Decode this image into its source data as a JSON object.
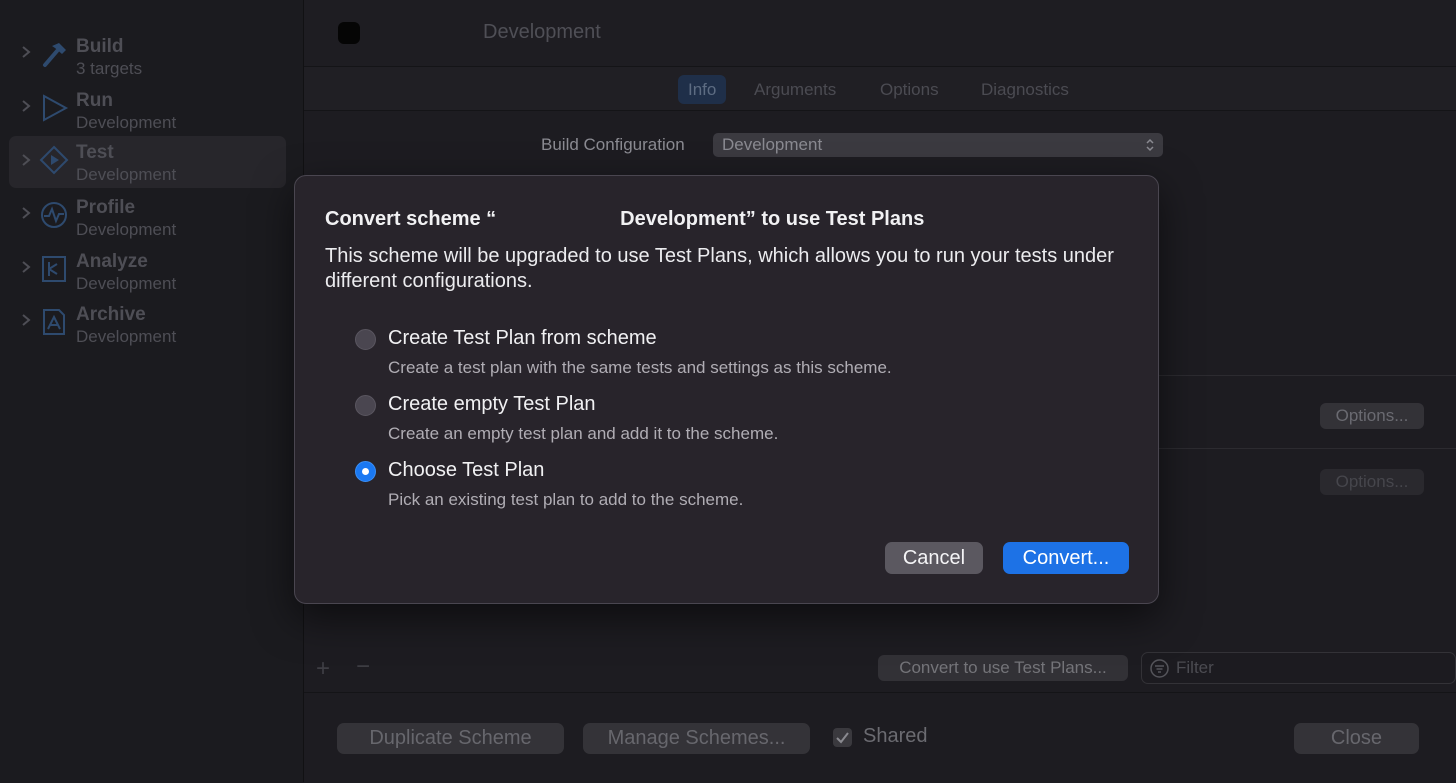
{
  "sidebar": {
    "items": [
      {
        "title": "Build",
        "subtitle": "3 targets",
        "icon": "hammer-icon"
      },
      {
        "title": "Run",
        "subtitle": "Development",
        "icon": "play-icon"
      },
      {
        "title": "Test",
        "subtitle": "Development",
        "icon": "test-diamond-icon"
      },
      {
        "title": "Profile",
        "subtitle": "Development",
        "icon": "instruments-icon"
      },
      {
        "title": "Analyze",
        "subtitle": "Development",
        "icon": "analyze-icon"
      },
      {
        "title": "Archive",
        "subtitle": "Development",
        "icon": "archive-icon"
      }
    ],
    "selected": "Test"
  },
  "header": {
    "scheme_name": "Development"
  },
  "tabs": [
    {
      "label": "Info",
      "active": true
    },
    {
      "label": "Arguments"
    },
    {
      "label": "Options"
    },
    {
      "label": "Diagnostics"
    }
  ],
  "info": {
    "build_config_label": "Build Configuration",
    "build_config_value": "Development",
    "options_label_1": "Options...",
    "options_label_2": "Options...",
    "convert_test_plans_label": "Convert to use Test Plans...",
    "filter_placeholder": "Filter"
  },
  "footer": {
    "duplicate": "Duplicate Scheme",
    "manage": "Manage Schemes...",
    "shared_label": "Shared",
    "shared_checked": true,
    "close": "Close"
  },
  "sheet": {
    "title_prefix": "Convert scheme “",
    "title_suffix": "Development” to use Test Plans",
    "description": "This scheme will be upgraded to use Test Plans, which allows you to run your tests under different configurations.",
    "options": [
      {
        "label": "Create Test Plan from scheme",
        "description": "Create a test plan with the same tests and settings as this scheme.",
        "selected": false
      },
      {
        "label": "Create empty Test Plan",
        "description": "Create an empty test plan and add it to the scheme.",
        "selected": false
      },
      {
        "label": "Choose Test Plan",
        "description": "Pick an existing test plan to add to the scheme.",
        "selected": true
      }
    ],
    "cancel": "Cancel",
    "convert": "Convert..."
  },
  "colors": {
    "accent": "#1d72e6",
    "sheet_bg": "#28242b",
    "window_bg": "#1d1c21"
  }
}
